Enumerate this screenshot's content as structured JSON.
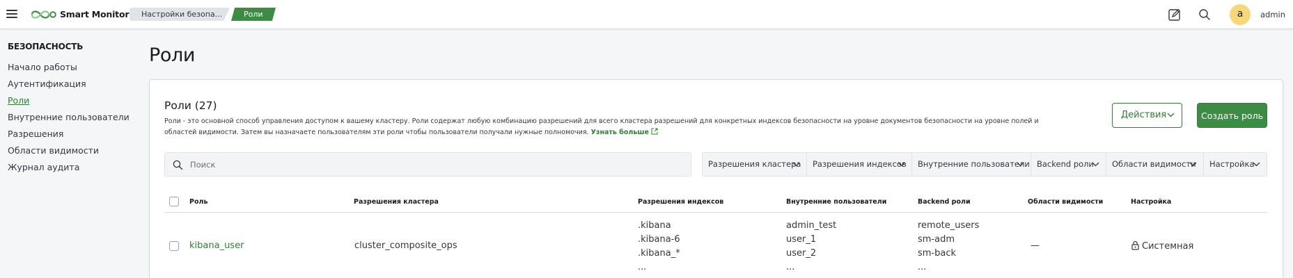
{
  "topbar": {
    "app_name": "Smart Monitor",
    "breadcrumbs": [
      "Настройки безопа...",
      "Роли"
    ],
    "avatar_letter": "a",
    "username": "admin"
  },
  "sidebar": {
    "title": "БЕЗОПАСНОСТЬ",
    "items": [
      {
        "label": "Начало работы",
        "active": false
      },
      {
        "label": "Аутентификация",
        "active": false
      },
      {
        "label": "Роли",
        "active": true
      },
      {
        "label": "Внутренние пользователи",
        "active": false
      },
      {
        "label": "Разрешения",
        "active": false
      },
      {
        "label": "Области видимости",
        "active": false
      },
      {
        "label": "Журнал аудита",
        "active": false
      }
    ]
  },
  "page": {
    "title": "Роли"
  },
  "panel": {
    "title": "Роли (27)",
    "description": "Роли - это основной способ управления доступом к вашему кластеру. Роли содержат любую комбинацию разрешений для всего кластера разрешений для конкретных индексов безопасности на уровне документов безопасности на уровне полей и областей видимости. Затем вы назначаете пользователям эти роли чтобы пользователи получали нужные полномочия.",
    "learn_more": "Узнать больше",
    "actions_label": "Действия",
    "create_label": "Создать роль",
    "search_placeholder": "Поиск",
    "filters": [
      "Разрешения кластера",
      "Разрешения индексов",
      "Внутренние пользователи",
      "Backend роли",
      "Области видимости",
      "Настройка"
    ]
  },
  "table": {
    "headers": [
      "Роль",
      "Разрешения кластера",
      "Разрешения индексов",
      "Внутренние пользователи",
      "Backend роли",
      "Области видимости",
      "Настройка"
    ],
    "rows": [
      {
        "role": "kibana_user",
        "cluster_permissions": "cluster_composite_ops",
        "index_permissions": [
          ".kibana",
          ".kibana-6",
          ".kibana_*",
          "..."
        ],
        "internal_users": [
          "admin_test",
          "user_1",
          "user_2",
          "..."
        ],
        "backend_roles": [
          "remote_users",
          "sm-adm",
          "sm-back",
          "..."
        ],
        "scopes": "—",
        "setting": "Системная"
      }
    ]
  },
  "colors": {
    "accent": "#3d8c45",
    "link": "#2f7d36",
    "avatar": "#f5d87a"
  },
  "icons": [
    "menu-icon",
    "infinity-logo-icon",
    "edit-icon",
    "search-icon",
    "external-link-icon",
    "chevron-down-icon",
    "lock-icon"
  ]
}
